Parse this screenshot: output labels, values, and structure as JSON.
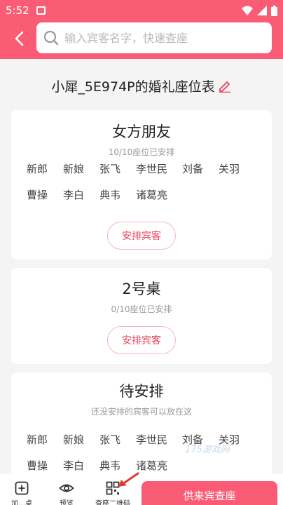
{
  "status_bar": {
    "time": "5:52"
  },
  "header": {
    "search_placeholder": "输入宾客名字，快速查座"
  },
  "page": {
    "title": "小犀_5E974P的婚礼座位表"
  },
  "tables": [
    {
      "name": "女方朋友",
      "status": "10/10座位已安排",
      "guests": [
        "新郎",
        "新娘",
        "张飞",
        "李世民",
        "刘备",
        "关羽",
        "曹操",
        "李白",
        "典韦",
        "诸葛亮"
      ],
      "button": "安排宾客"
    },
    {
      "name": "2号桌",
      "status": "0/10座位已安排",
      "guests": [],
      "button": "安排宾客"
    },
    {
      "name": "待安排",
      "status": "还没安排的宾客可以放在这",
      "guests": [
        "新郎",
        "新娘",
        "张飞",
        "李世民",
        "刘备",
        "关羽",
        "曹操",
        "李白",
        "典韦",
        "诸葛亮"
      ]
    }
  ],
  "bottom_bar": {
    "add_label": "加…桌",
    "preview_label": "预览",
    "qr_label": "查座二维码",
    "cta_label": "供来宾查座"
  },
  "watermark": "175游戏网",
  "colors": {
    "accent": "#fb5c75",
    "button_text": "#e8435f"
  }
}
